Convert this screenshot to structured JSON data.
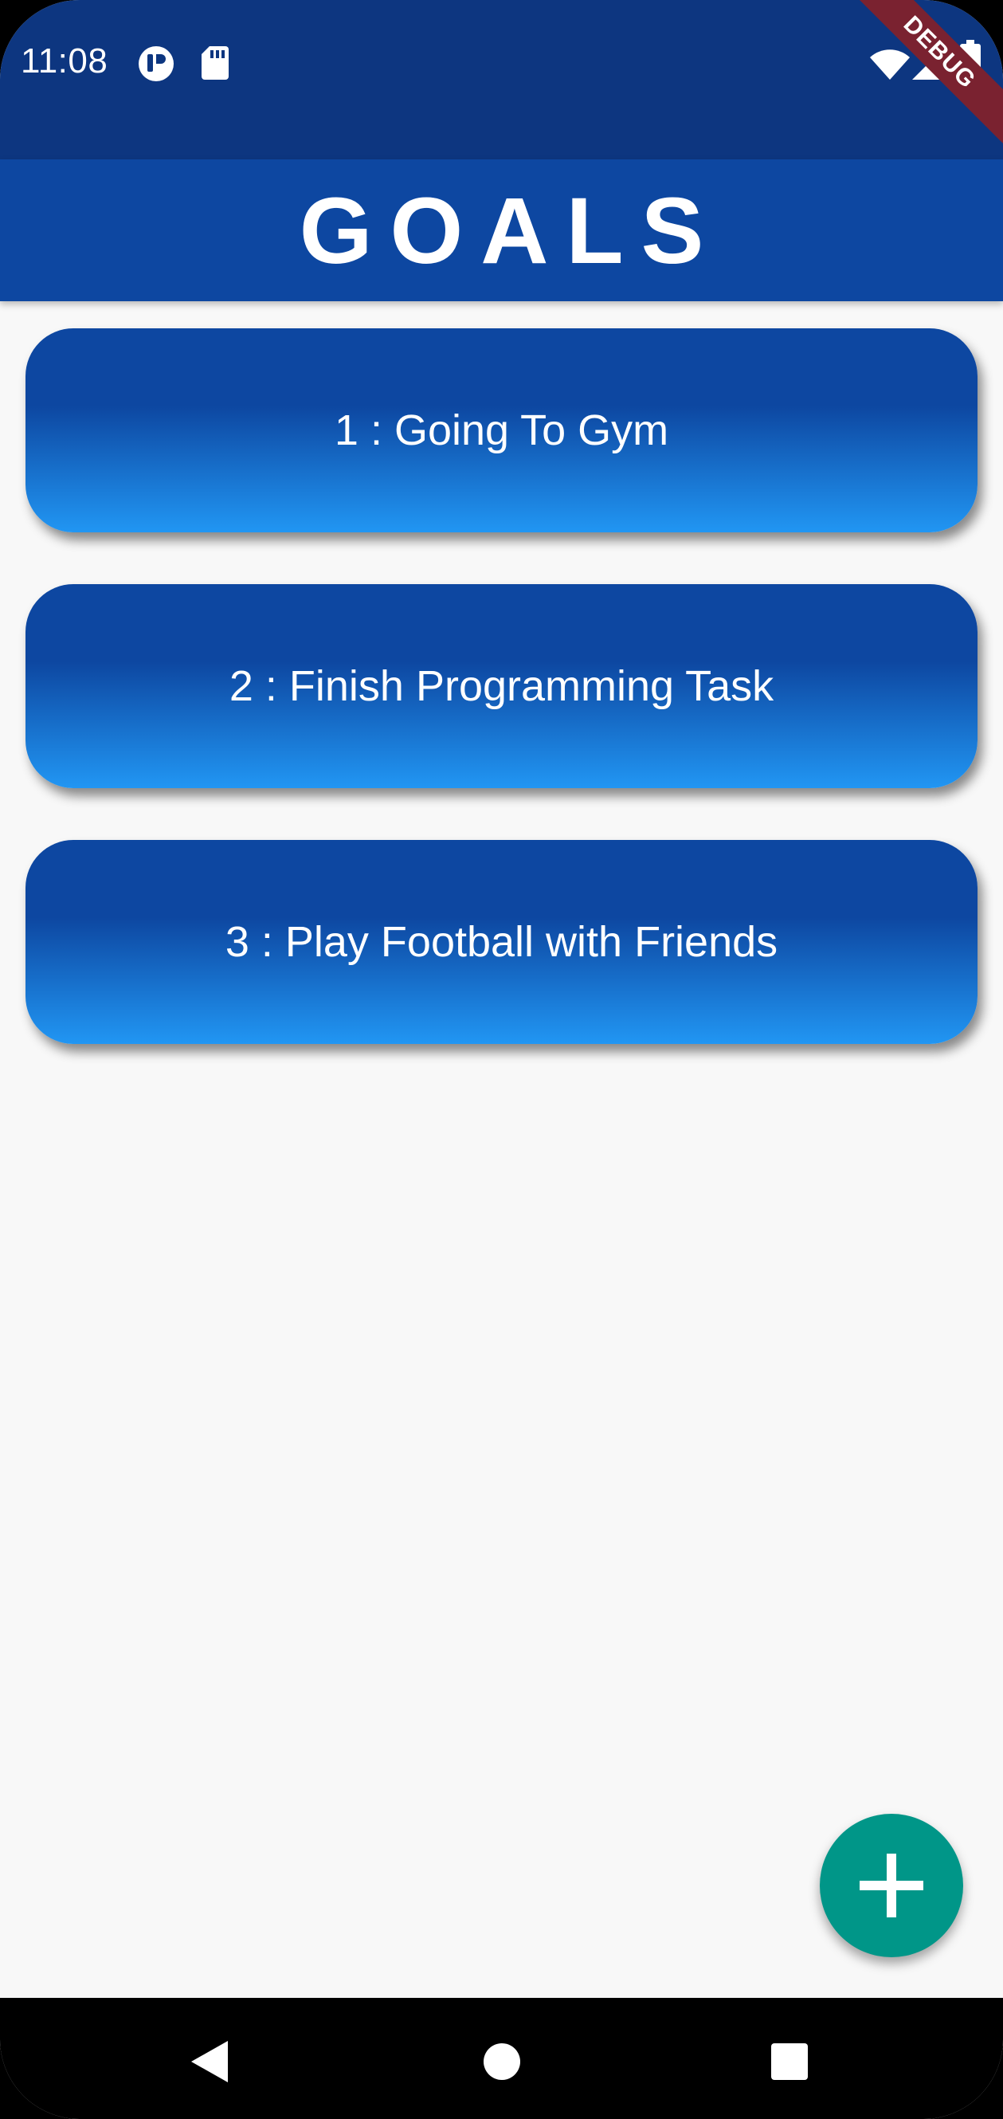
{
  "status_bar": {
    "time": "11:08",
    "icons": [
      "notification-app-icon",
      "sd-card-icon",
      "wifi-icon",
      "signal-icon",
      "battery-icon"
    ]
  },
  "debug_banner": {
    "label": "DEBUG"
  },
  "app_bar": {
    "title": "GOALS"
  },
  "goals": [
    {
      "label": "1 : Going To Gym"
    },
    {
      "label": "2 : Finish Programming Task"
    },
    {
      "label": "3 : Play Football with Friends"
    }
  ],
  "fab": {
    "icon": "plus-icon"
  },
  "navigation": {
    "buttons": [
      "back-icon",
      "home-icon",
      "recents-icon"
    ]
  },
  "colors": {
    "status_bar": "#0d3680",
    "app_bar": "#0d47a1",
    "card_gradient_top": "#0d47a1",
    "card_gradient_bottom": "#2196f3",
    "fab": "#009688",
    "background": "#f8f8f8"
  }
}
